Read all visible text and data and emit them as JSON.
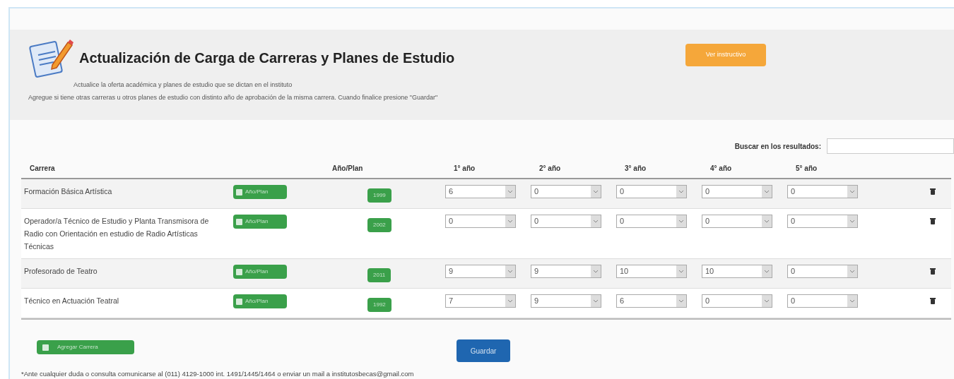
{
  "header": {
    "title": "Actualización de Carga de Carreras y Planes de Estudio",
    "subtitle": "Actualice la oferta académica y planes de estudio que se dictan en el instituto",
    "instructions": "Agregue si tiene otras carreras u otros planes de estudio con distinto año de aprobación de la misma carrera. Cuando finalice presione \"Guardar\"",
    "instructions_button": "Ver instructivo"
  },
  "search": {
    "label": "Buscar en los resultados:"
  },
  "table": {
    "columns": [
      "Carrera",
      "Año/Plan",
      "1° año",
      "2° año",
      "3° año",
      "4° año",
      "5° año"
    ],
    "rows": [
      {
        "carrera": "Formación Básica Artística",
        "add_button": "Año/Plan",
        "plan": "1999",
        "years": [
          "6",
          "0",
          "0",
          "0",
          "0"
        ]
      },
      {
        "carrera": "Operador/a Técnico de Estudio y Planta Transmisora de Radio con Orientación en estudio de Radio Artísticas Técnicas",
        "add_button": "Año/Plan",
        "plan": "2002",
        "years": [
          "0",
          "0",
          "0",
          "0",
          "0"
        ]
      },
      {
        "carrera": "Profesorado de Teatro",
        "add_button": "Año/Plan",
        "plan": "2011",
        "years": [
          "9",
          "9",
          "10",
          "10",
          "0"
        ]
      },
      {
        "carrera": "Técnico en Actuación Teatral",
        "add_button": "Año/Plan",
        "plan": "1992",
        "years": [
          "7",
          "9",
          "6",
          "0",
          "0"
        ]
      }
    ]
  },
  "add_career_button": "Agregar Carrera",
  "save_button": "Guardar",
  "footer": "*Ante cualquier duda o consulta comunicarse al (011) 4129-1000 int. 1491/1445/1464 o enviar un mail a institutosbecas@gmail.com"
}
